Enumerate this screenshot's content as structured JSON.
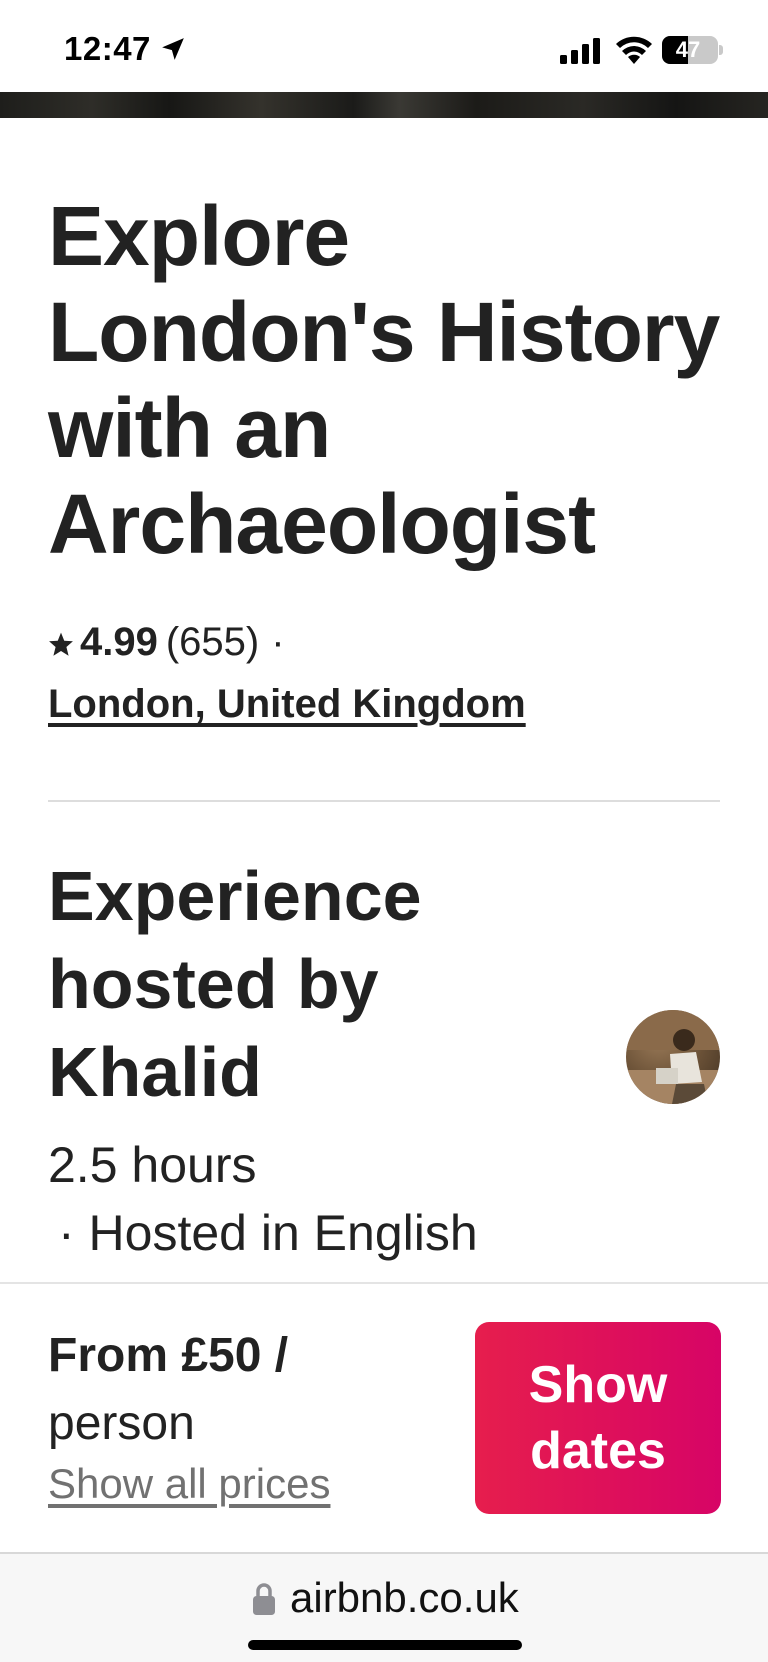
{
  "status_bar": {
    "time": "12:47",
    "battery": "47",
    "battery_level_percent": 47,
    "icons": [
      "location-arrow-icon",
      "cellular-signal-icon",
      "wifi-icon",
      "battery-icon"
    ]
  },
  "listing": {
    "title": "Explore London's History with an Archaeologist",
    "rating": "4.99",
    "reviews": "(655)",
    "separator": "·",
    "location": "London, United Kingdom",
    "host_heading": "Experience hosted by Khalid",
    "duration": "2.5 hours",
    "language": "· Hosted in English"
  },
  "booking": {
    "price_from": "From £50 /",
    "price_unit": "person",
    "show_all_prices": "Show all prices",
    "show_dates": "Show dates"
  },
  "browser": {
    "url": "airbnb.co.uk"
  },
  "colors": {
    "brand_start": "#e61e4d",
    "brand_end": "#d70466",
    "text": "#222222",
    "muted": "#717171"
  }
}
